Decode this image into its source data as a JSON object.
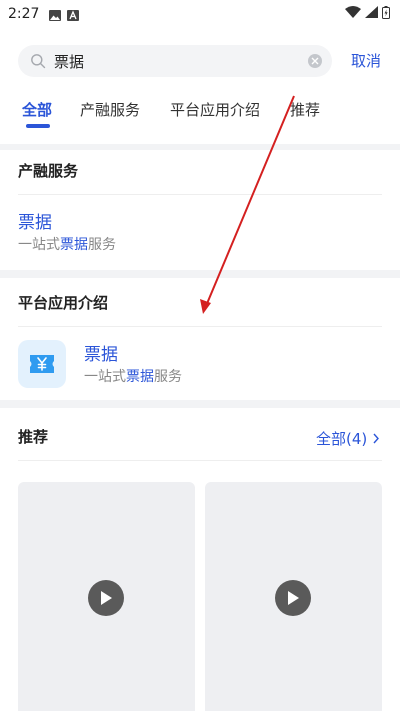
{
  "status_bar": {
    "time": "2:27",
    "icons": [
      "image-icon",
      "a-icon",
      "wifi-icon",
      "signal-icon",
      "battery-icon"
    ]
  },
  "search": {
    "value": "票据",
    "cancel_label": "取消"
  },
  "tabs": [
    {
      "label": "全部",
      "active": true
    },
    {
      "label": "产融服务",
      "active": false
    },
    {
      "label": "平台应用介绍",
      "active": false
    },
    {
      "label": "推荐",
      "active": false
    }
  ],
  "sections": {
    "finance_service": {
      "title": "产融服务",
      "result": {
        "title": "票据",
        "desc_prefix": "一站式",
        "desc_highlight": "票据",
        "desc_suffix": "服务"
      }
    },
    "platform_app": {
      "title": "平台应用介绍",
      "result": {
        "title": "票据",
        "desc_prefix": "一站式",
        "desc_highlight": "票据",
        "desc_suffix": "服务",
        "icon": "ticket-yen-icon"
      }
    },
    "recommend": {
      "title": "推荐",
      "see_all": "全部(4)",
      "videos": [
        {
          "icon": "play-icon"
        },
        {
          "icon": "play-icon"
        }
      ]
    }
  },
  "colors": {
    "accent": "#2b55d8",
    "annotation_arrow": "#d42020",
    "page_bg": "#f2f3f5",
    "app_icon_bg": "#2f9bf0"
  }
}
